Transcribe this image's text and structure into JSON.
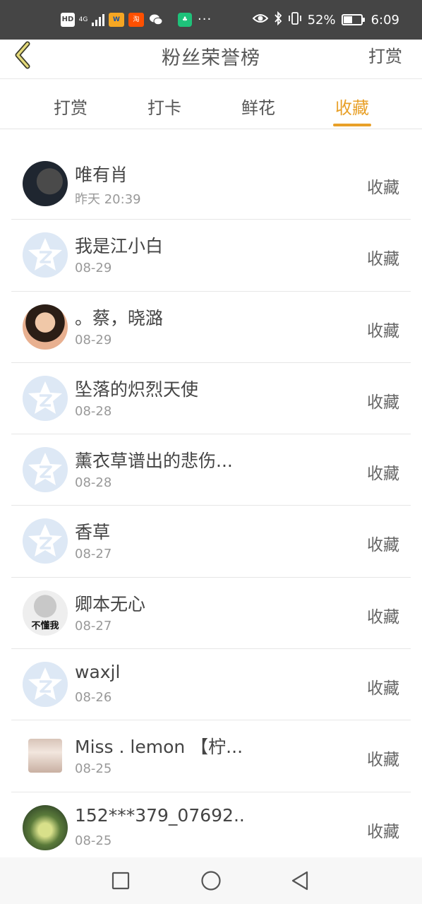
{
  "status_bar": {
    "hd_label": "HD",
    "network_label": "4G",
    "app_icons": [
      "weibo-icon",
      "taobao-icon",
      "wechat-icon",
      "game-icon"
    ],
    "dots": "···",
    "battery_text": "52%",
    "battery_level": 0.52,
    "time": "6:09"
  },
  "header": {
    "title": "粉丝荣誉榜",
    "action_label": "打赏",
    "back_icon": "chevron-left-icon"
  },
  "tabs": [
    {
      "label": "打赏",
      "active": false
    },
    {
      "label": "打卡",
      "active": false
    },
    {
      "label": "鲜花",
      "active": false
    },
    {
      "label": "收藏",
      "active": true
    }
  ],
  "colors": {
    "accent": "#e8a028",
    "back_arrow": "#d6c96a",
    "status_bar": "#454545",
    "default_avatar": "#dde8f5"
  },
  "fans": [
    {
      "name": "唯有肖",
      "time": "昨天 20:39",
      "action": "收藏",
      "avatar": "photo"
    },
    {
      "name": "我是江小白",
      "time": "08-29",
      "action": "收藏",
      "avatar": "default"
    },
    {
      "name": "。蔡，晓潞",
      "time": "08-29",
      "action": "收藏",
      "avatar": "photo"
    },
    {
      "name": "坠落的炽烈天使",
      "time": "08-28",
      "action": "收藏",
      "avatar": "default"
    },
    {
      "name": "薰衣草谱出的悲伤...",
      "time": "08-28",
      "action": "收藏",
      "avatar": "default"
    },
    {
      "name": "香草",
      "time": "08-27",
      "action": "收藏",
      "avatar": "default"
    },
    {
      "name": "卿本无心",
      "time": "08-27",
      "action": "收藏",
      "avatar": "photo",
      "avatar_text": "不懂我"
    },
    {
      "name": "waxjl",
      "time": "08-26",
      "action": "收藏",
      "avatar": "default"
    },
    {
      "name": "Miss . lemon 【柠...",
      "time": "08-25",
      "action": "收藏",
      "avatar": "photo"
    },
    {
      "name": "152***379_07692...",
      "time": "08-25",
      "action": "收藏",
      "avatar": "photo"
    }
  ],
  "nav": {
    "recents": "square-icon",
    "home": "circle-icon",
    "back": "triangle-back-icon"
  }
}
